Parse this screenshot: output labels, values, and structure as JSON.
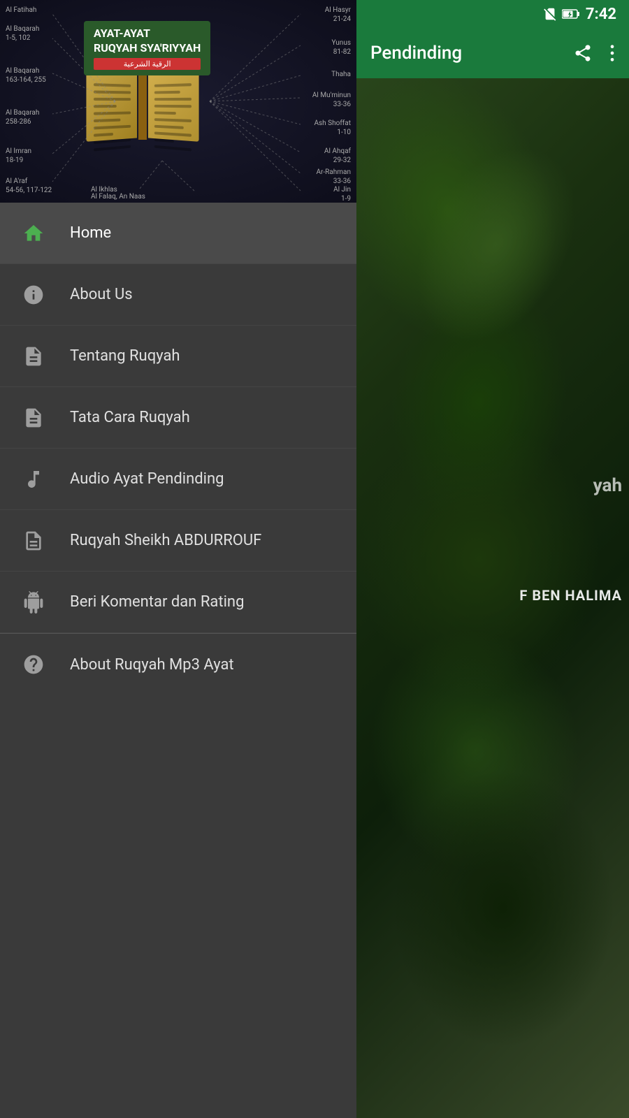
{
  "statusBar": {
    "time": "7:42"
  },
  "appBar": {
    "title": "Pendinding",
    "shareIcon": "share-icon",
    "moreIcon": "more-icon"
  },
  "backgroundContent": {
    "text1": "yah",
    "text2": "F BEN HALIMA"
  },
  "drawer": {
    "header": {
      "title1": "AYAT-AYAT",
      "title2": "RUQYAH SYA'RIYYAH",
      "subtitle": "الرقية الشرعية",
      "surahLabels": [
        {
          "text": "Al Fatihah",
          "position": "top-left-1"
        },
        {
          "text": "Al Baqarah\n1-5, 102",
          "position": "top-left-2"
        },
        {
          "text": "Al Baqarah\n163-164, 255",
          "position": "mid-left"
        },
        {
          "text": "Al Baqarah\n258-286",
          "position": "lower-left"
        },
        {
          "text": "Al Imran\n18-19",
          "position": "bottom-left"
        },
        {
          "text": "Al A'raf\n54-56, 117-122",
          "position": "bottom-left-2"
        },
        {
          "text": "Al Hasyr\n21-24",
          "position": "top-right-1"
        },
        {
          "text": "Yunus\n81-82",
          "position": "top-right-2"
        },
        {
          "text": "Thaha",
          "position": "top-right-3"
        },
        {
          "text": "Al Mu'minun\n33-36",
          "position": "mid-right"
        },
        {
          "text": "Ash Shoffat\n1-10",
          "position": "mid-right-2"
        },
        {
          "text": "Al Ahqaf\n29-32",
          "position": "lower-right"
        },
        {
          "text": "Ar-Rahman\n33-36",
          "position": "lower-right-2"
        },
        {
          "text": "Al Jin\n1-9",
          "position": "bottom-right"
        },
        {
          "text": "Al Ikhlas",
          "position": "bottom-center-1"
        },
        {
          "text": "Al Falaq, An Naas",
          "position": "bottom-center-2"
        }
      ]
    },
    "menuItems": [
      {
        "id": "home",
        "label": "Home",
        "icon": "home-icon",
        "active": true
      },
      {
        "id": "about-us",
        "label": "About Us",
        "icon": "info-icon",
        "active": false
      },
      {
        "id": "tentang-ruqyah",
        "label": "Tentang Ruqyah",
        "icon": "document-icon",
        "active": false
      },
      {
        "id": "tata-cara-ruqyah",
        "label": "Tata Cara Ruqyah",
        "icon": "document-icon",
        "active": false
      },
      {
        "id": "audio-ayat-pendinding",
        "label": "Audio Ayat Pendinding",
        "icon": "music-icon",
        "active": false
      },
      {
        "id": "ruqyah-sheikh",
        "label": "Ruqyah Sheikh ABDURROUF",
        "icon": "document-list-icon",
        "active": false
      },
      {
        "id": "beri-komentar",
        "label": "Beri Komentar dan Rating",
        "icon": "android-icon",
        "active": false
      },
      {
        "id": "about-ruqyah",
        "label": "About Ruqyah Mp3 Ayat",
        "icon": "help-icon",
        "active": false
      }
    ]
  }
}
